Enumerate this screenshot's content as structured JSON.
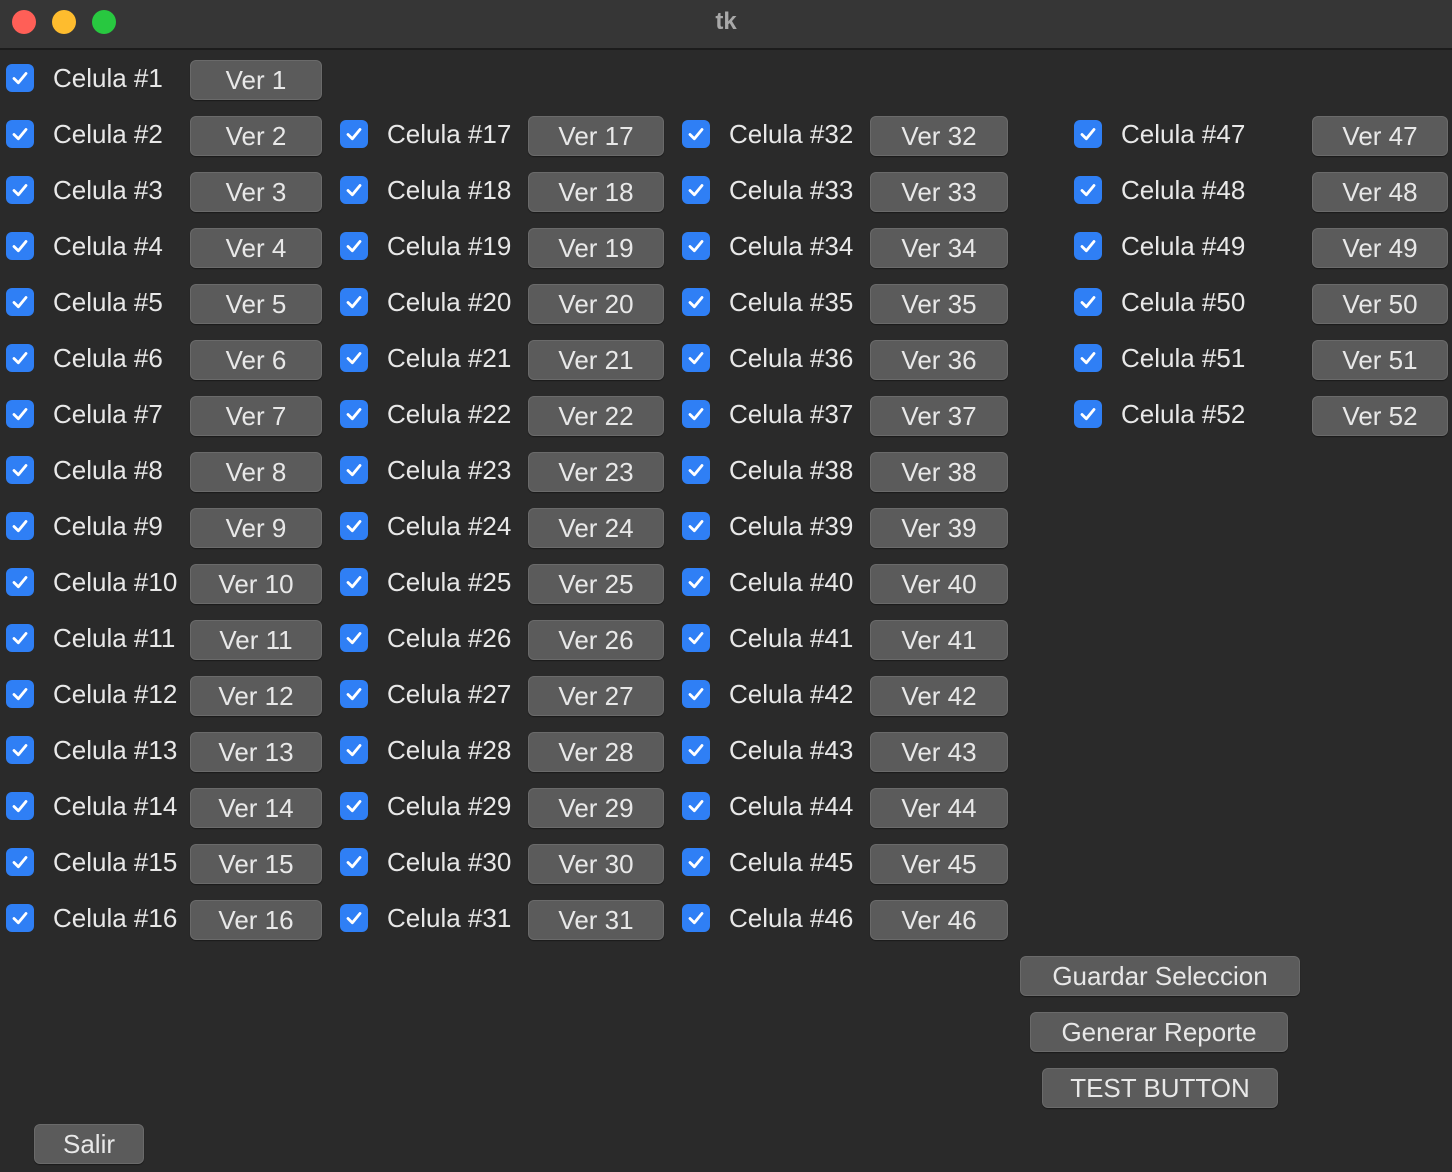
{
  "window": {
    "title": "tk"
  },
  "check_color": "#2f7ff5",
  "cells": [
    {
      "label": "Celula #1",
      "button": "Ver 1",
      "checked": true
    },
    {
      "label": "Celula #2",
      "button": "Ver 2",
      "checked": true
    },
    {
      "label": "Celula #3",
      "button": "Ver 3",
      "checked": true
    },
    {
      "label": "Celula #4",
      "button": "Ver 4",
      "checked": true
    },
    {
      "label": "Celula #5",
      "button": "Ver 5",
      "checked": true
    },
    {
      "label": "Celula #6",
      "button": "Ver 6",
      "checked": true
    },
    {
      "label": "Celula #7",
      "button": "Ver 7",
      "checked": true
    },
    {
      "label": "Celula #8",
      "button": "Ver 8",
      "checked": true
    },
    {
      "label": "Celula #9",
      "button": "Ver 9",
      "checked": true
    },
    {
      "label": "Celula #10",
      "button": "Ver 10",
      "checked": true
    },
    {
      "label": "Celula #11",
      "button": "Ver 11",
      "checked": true
    },
    {
      "label": "Celula #12",
      "button": "Ver 12",
      "checked": true
    },
    {
      "label": "Celula #13",
      "button": "Ver 13",
      "checked": true
    },
    {
      "label": "Celula #14",
      "button": "Ver 14",
      "checked": true
    },
    {
      "label": "Celula #15",
      "button": "Ver 15",
      "checked": true
    },
    {
      "label": "Celula #16",
      "button": "Ver 16",
      "checked": true
    },
    {
      "label": "Celula #17",
      "button": "Ver 17",
      "checked": true
    },
    {
      "label": "Celula #18",
      "button": "Ver 18",
      "checked": true
    },
    {
      "label": "Celula #19",
      "button": "Ver 19",
      "checked": true
    },
    {
      "label": "Celula #20",
      "button": "Ver 20",
      "checked": true
    },
    {
      "label": "Celula #21",
      "button": "Ver 21",
      "checked": true
    },
    {
      "label": "Celula #22",
      "button": "Ver 22",
      "checked": true
    },
    {
      "label": "Celula #23",
      "button": "Ver 23",
      "checked": true
    },
    {
      "label": "Celula #24",
      "button": "Ver 24",
      "checked": true
    },
    {
      "label": "Celula #25",
      "button": "Ver 25",
      "checked": true
    },
    {
      "label": "Celula #26",
      "button": "Ver 26",
      "checked": true
    },
    {
      "label": "Celula #27",
      "button": "Ver 27",
      "checked": true
    },
    {
      "label": "Celula #28",
      "button": "Ver 28",
      "checked": true
    },
    {
      "label": "Celula #29",
      "button": "Ver 29",
      "checked": true
    },
    {
      "label": "Celula #30",
      "button": "Ver 30",
      "checked": true
    },
    {
      "label": "Celula #31",
      "button": "Ver 31",
      "checked": true
    },
    {
      "label": "Celula #32",
      "button": "Ver 32",
      "checked": true
    },
    {
      "label": "Celula #33",
      "button": "Ver 33",
      "checked": true
    },
    {
      "label": "Celula #34",
      "button": "Ver 34",
      "checked": true
    },
    {
      "label": "Celula #35",
      "button": "Ver 35",
      "checked": true
    },
    {
      "label": "Celula #36",
      "button": "Ver 36",
      "checked": true
    },
    {
      "label": "Celula #37",
      "button": "Ver 37",
      "checked": true
    },
    {
      "label": "Celula #38",
      "button": "Ver 38",
      "checked": true
    },
    {
      "label": "Celula #39",
      "button": "Ver 39",
      "checked": true
    },
    {
      "label": "Celula #40",
      "button": "Ver 40",
      "checked": true
    },
    {
      "label": "Celula #41",
      "button": "Ver 41",
      "checked": true
    },
    {
      "label": "Celula #42",
      "button": "Ver 42",
      "checked": true
    },
    {
      "label": "Celula #43",
      "button": "Ver 43",
      "checked": true
    },
    {
      "label": "Celula #44",
      "button": "Ver 44",
      "checked": true
    },
    {
      "label": "Celula #45",
      "button": "Ver 45",
      "checked": true
    },
    {
      "label": "Celula #46",
      "button": "Ver 46",
      "checked": true
    },
    {
      "label": "Celula #47",
      "button": "Ver 47",
      "checked": true
    },
    {
      "label": "Celula #48",
      "button": "Ver 48",
      "checked": true
    },
    {
      "label": "Celula #49",
      "button": "Ver 49",
      "checked": true
    },
    {
      "label": "Celula #50",
      "button": "Ver 50",
      "checked": true
    },
    {
      "label": "Celula #51",
      "button": "Ver 51",
      "checked": true
    },
    {
      "label": "Celula #52",
      "button": "Ver 52",
      "checked": true
    }
  ],
  "actions": {
    "guardar": "Guardar Seleccion",
    "generar": "Generar Reporte",
    "test": "TEST BUTTON",
    "salir": "Salir"
  }
}
